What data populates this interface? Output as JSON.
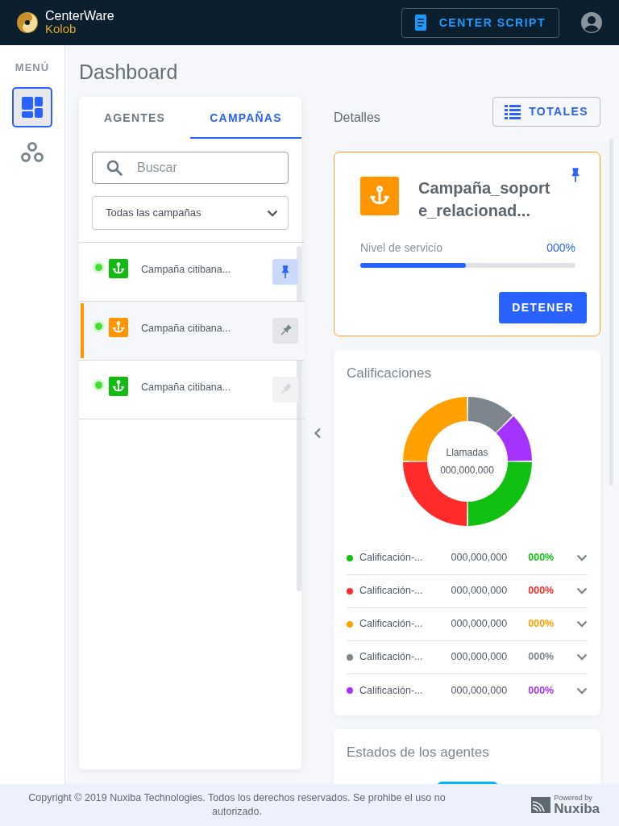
{
  "header": {
    "brand_name": "CenterWare",
    "brand_product": "Kolob",
    "script_button": "CENTER SCRIPT"
  },
  "sidebar": {
    "title": "MENÚ",
    "items": [
      {
        "kind": "dashboard",
        "selected": true
      },
      {
        "kind": "groups",
        "selected": false
      }
    ]
  },
  "page_title": "Dashboard",
  "tabs": [
    {
      "label": "AGENTES",
      "selected": false
    },
    {
      "label": "CAMPAÑAS",
      "selected": true
    }
  ],
  "search": {
    "placeholder": "Buscar"
  },
  "filter": {
    "value": "Todas las campañas"
  },
  "campaigns": [
    {
      "name": "Campaña citibana...",
      "online": true,
      "color": "#11bb11",
      "selected": false,
      "pinned": true,
      "disabled": false
    },
    {
      "name": "Campaña citibana...",
      "online": true,
      "color": "#ff9500",
      "selected": true,
      "pinned": false,
      "disabled": false
    },
    {
      "name": "Campaña citibana...",
      "online": true,
      "color": "#11bb11",
      "selected": false,
      "pinned": false,
      "disabled": true
    }
  ],
  "details": {
    "title": "Detalles",
    "totals_button": "TOTALES",
    "campaign": {
      "name": "Campaña_soporte_relacionad...",
      "color": "#ff9500",
      "pinned": true,
      "service_label": "Nivel de servicio",
      "service_value": "000%",
      "level": 0.49,
      "stop_button": "DETENER"
    }
  },
  "ratings": {
    "title": "Calificaciones",
    "center_label": "Llamadas",
    "center_value": "000,000,000",
    "rows": [
      {
        "name": "Calificación-...",
        "count": "000,000,000",
        "percent": "000%",
        "color": "#11c111"
      },
      {
        "name": "Calificación-...",
        "count": "000,000,000",
        "percent": "000%",
        "color": "#ff2a2a"
      },
      {
        "name": "Calificación-...",
        "count": "000,000,000",
        "percent": "000%",
        "color": "#ff9f00"
      },
      {
        "name": "Calificación-...",
        "count": "000,000,000",
        "percent": "000%",
        "color": "#7d868c"
      },
      {
        "name": "Calificación-...",
        "count": "000,000,000",
        "percent": "000%",
        "color": "#a533ff"
      }
    ]
  },
  "agent_states": {
    "title": "Estados de los agentes"
  },
  "footer": {
    "copyright": "Copyright © 2019 Nuxiba Technologies. Todos los derechos reservados. Se prohibe el uso no autorizado.",
    "powered_label": "Powered by",
    "powered_brand": "Nuxiba"
  }
}
